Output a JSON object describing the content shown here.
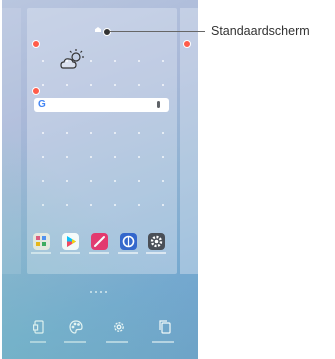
{
  "callout": {
    "label": "Standaardscherm"
  },
  "home_screen": {
    "search": {
      "logo": "G",
      "mic_icon": "mic-icon"
    },
    "weather_icon": "partly-sunny-cloud-icon",
    "apps": [
      {
        "name": "folder-icon",
        "color": "#f5f0e8"
      },
      {
        "name": "play-store-icon",
        "color": "#ffffff"
      },
      {
        "name": "pen-app-icon",
        "color": "#e8336b"
      },
      {
        "name": "compass-app-icon",
        "color": "#3366cc"
      },
      {
        "name": "settings-app-icon",
        "color": "#4a4f57"
      }
    ],
    "bottom_actions": [
      "wallpaper-icon",
      "themes-icon",
      "settings-icon",
      "apps-page-icon"
    ]
  },
  "colors": {
    "handle": "#ff5c4a",
    "callout_line": "#666666",
    "label_text": "#333333"
  }
}
